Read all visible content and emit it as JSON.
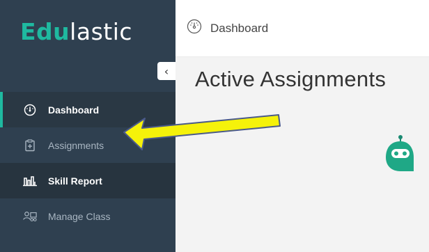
{
  "app": {
    "logo_accent": "Edu",
    "logo_rest": "lastic"
  },
  "sidebar": {
    "collapse_icon": "chevron-left-icon",
    "items": [
      {
        "label": "Dashboard",
        "icon": "dashboard-gauge-icon",
        "state": "active"
      },
      {
        "label": "Assignments",
        "icon": "clipboard-plus-icon",
        "state": "dim"
      },
      {
        "label": "Skill Report",
        "icon": "bar-chart-icon",
        "state": "bold"
      },
      {
        "label": "Manage Class",
        "icon": "manage-class-icon",
        "state": "dim"
      }
    ]
  },
  "header": {
    "breadcrumb": "Dashboard",
    "breadcrumb_icon": "dashboard-gauge-icon"
  },
  "main": {
    "title": "Active Assignments",
    "mascot_icon": "robot-chat-icon"
  },
  "annotation": {
    "arrow_color": "#f5f20a",
    "arrow_target": "Assignments"
  },
  "colors": {
    "sidebar_bg": "#2f4050",
    "accent": "#1fb9a0",
    "main_bg": "#f3f3f3"
  }
}
